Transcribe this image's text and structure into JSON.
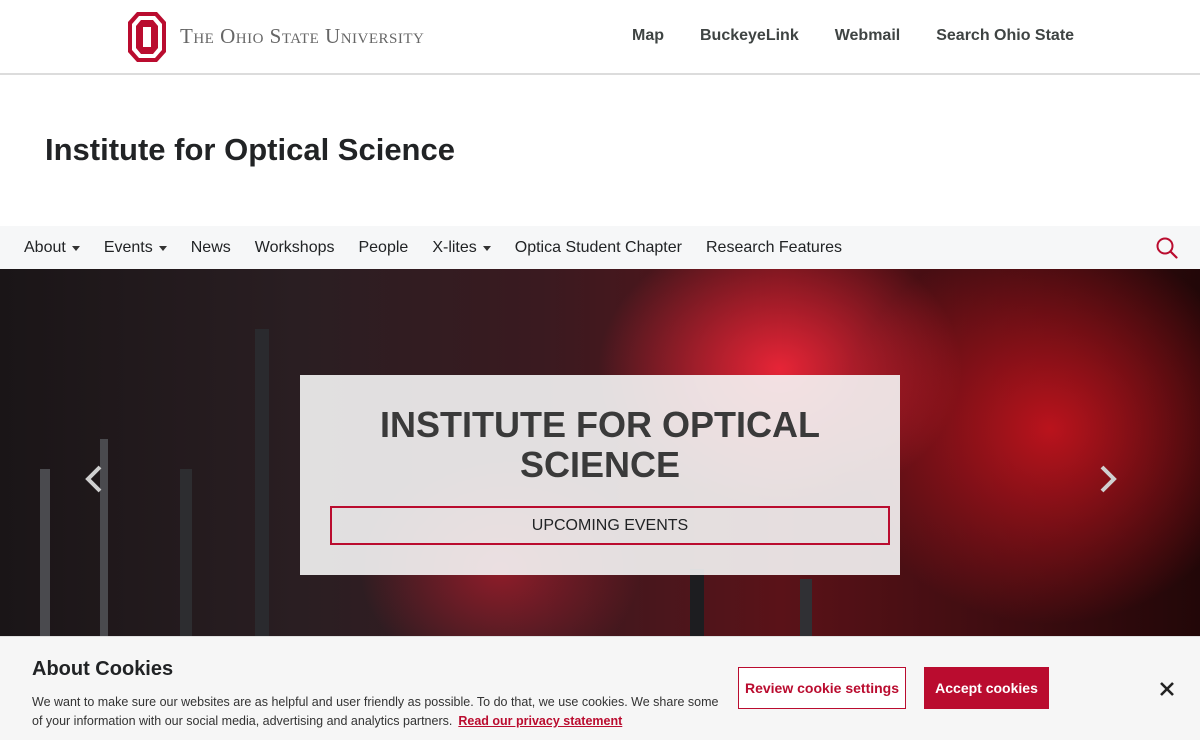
{
  "header": {
    "wordmark": "The Ohio State University",
    "links": [
      {
        "label": "Map"
      },
      {
        "label": "BuckeyeLink"
      },
      {
        "label": "Webmail"
      },
      {
        "label": "Search Ohio State"
      }
    ]
  },
  "site": {
    "title": "Institute for Optical Science"
  },
  "nav": {
    "items": [
      {
        "label": "About",
        "dropdown": true
      },
      {
        "label": "Events",
        "dropdown": true
      },
      {
        "label": "News",
        "dropdown": false
      },
      {
        "label": "Workshops",
        "dropdown": false
      },
      {
        "label": "People",
        "dropdown": false
      },
      {
        "label": "X-lites",
        "dropdown": true
      },
      {
        "label": "Optica Student Chapter",
        "dropdown": false
      },
      {
        "label": "Research Features",
        "dropdown": false
      }
    ],
    "search_icon": "search-icon"
  },
  "hero": {
    "heading": "INSTITUTE FOR OPTICAL SCIENCE",
    "button_label": "UPCOMING EVENTS",
    "prev_icon": "chevron-left-icon",
    "next_icon": "chevron-right-icon"
  },
  "cookie": {
    "title": "About Cookies",
    "text": "We want to make sure our websites are as helpful and user friendly as possible. To do that, we use cookies. We share some of your information with our social media, advertising and analytics partners.",
    "privacy_link": "Read our privacy statement",
    "review_label": "Review cookie settings",
    "accept_label": "Accept cookies",
    "close_icon": "close-icon"
  },
  "colors": {
    "brand_scarlet": "#ba0c2f",
    "nav_bg": "#f6f7f8",
    "cookie_bg": "#f6f6f6"
  }
}
